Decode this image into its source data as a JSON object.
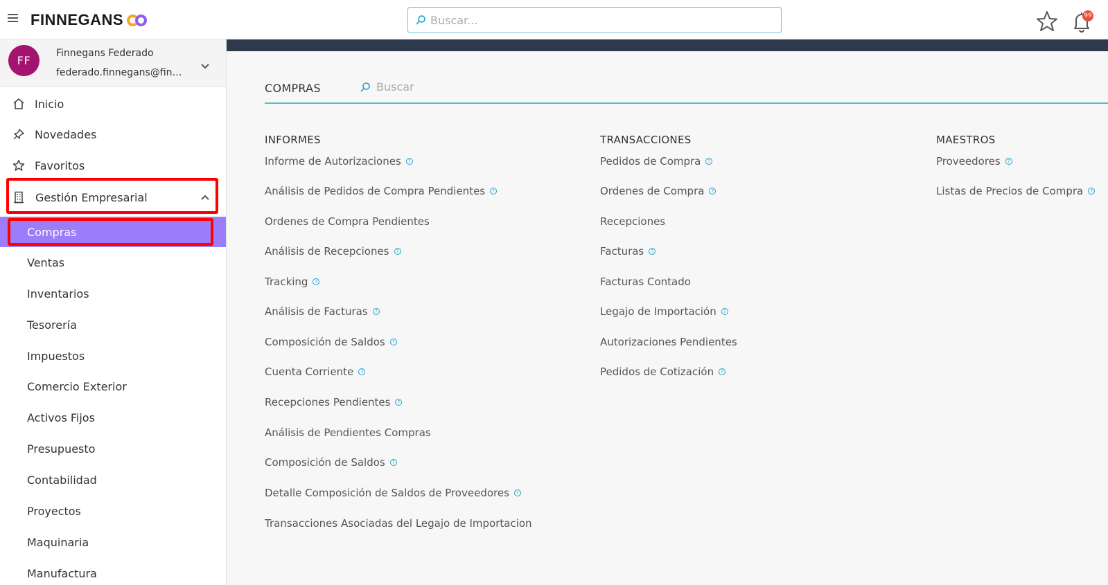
{
  "header": {
    "brand": "FINNEGANS",
    "search_placeholder": "Buscar...",
    "notification_badge": "99"
  },
  "user": {
    "initials": "FF",
    "name": "Finnegans Federado",
    "email": "federado.finnegans@fin…"
  },
  "nav": {
    "inicio": "Inicio",
    "novedades": "Novedades",
    "favoritos": "Favoritos",
    "gestion": "Gestión Empresarial",
    "subitems": [
      "Compras",
      "Ventas",
      "Inventarios",
      "Tesorería",
      "Impuestos",
      "Comercio Exterior",
      "Activos Fijos",
      "Presupuesto",
      "Contabilidad",
      "Proyectos",
      "Maquinaria",
      "Manufactura"
    ],
    "active_subitem": "Compras"
  },
  "module": {
    "title": "COMPRAS",
    "search_placeholder": "Buscar"
  },
  "columns": {
    "informes": {
      "title": "INFORMES",
      "items": [
        "Informe de Autorizaciones",
        "Análisis de Pedidos de Compra Pendientes",
        "Ordenes de Compra Pendientes",
        "Análisis de Recepciones",
        "Tracking",
        "Análisis de Facturas",
        "Composición de Saldos",
        "Cuenta Corriente",
        "Recepciones Pendientes",
        "Análisis de Pendientes Compras",
        "Composición de Saldos",
        "Detalle Composición de Saldos de Proveedores",
        "Transacciones Asociadas del Legajo de Importacion"
      ]
    },
    "transacciones": {
      "title": "TRANSACCIONES",
      "items": [
        "Pedidos de Compra",
        "Ordenes de Compra",
        "Recepciones",
        "Facturas",
        "Facturas Contado",
        "Legajo de Importación",
        "Autorizaciones Pendientes",
        "Pedidos de Cotización"
      ]
    },
    "maestros": {
      "title": "MAESTROS",
      "items": [
        "Proveedores",
        "Listas de Precios de Compra"
      ]
    }
  },
  "colors": {
    "accent_purple": "#9b7dfb",
    "avatar": "#a3146e",
    "link_accent": "#1fa2c9",
    "highlight": "#ff0000"
  }
}
